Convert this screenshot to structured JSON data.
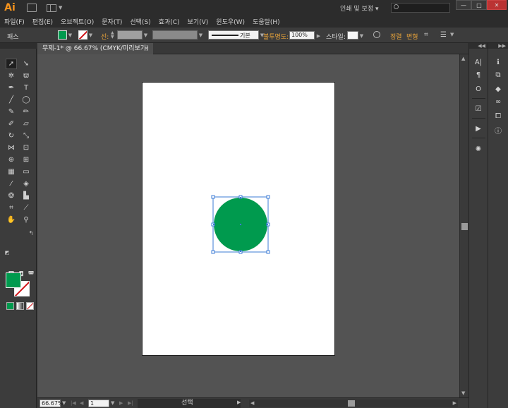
{
  "app": {
    "logo_text": "Ai",
    "workspace_label": "인쇄 및 보정",
    "search_placeholder": "",
    "window_controls": [
      "—",
      "□",
      "✕"
    ]
  },
  "menu": [
    "파일(F)",
    "편집(E)",
    "오브젝트(O)",
    "문자(T)",
    "선택(S)",
    "효과(C)",
    "보기(V)",
    "윈도우(W)",
    "도움말(H)"
  ],
  "controlbar": {
    "selection_label": "패스",
    "fill_color": "#009a4e",
    "stroke_label": "선:",
    "stroke_style_label": "기본",
    "opacity_label": "불투명도:",
    "opacity_value": "100%",
    "style_label": "스타일:",
    "align_label": "정렬",
    "transform_label": "변형"
  },
  "document": {
    "tab_title": "무제-1* @ 66.67% (CMYK/미리보기)",
    "tab_close": "×",
    "artboard_color": "#ffffff",
    "object": {
      "type": "circle",
      "fill": "#009a4e",
      "selected": true,
      "selection_color": "#3b7bd6"
    }
  },
  "statusbar": {
    "zoom": "66.67%",
    "page": "1",
    "status_text": "선택"
  },
  "tools": {
    "fill_color": "#009a4e",
    "stroke_color": "none"
  },
  "colors": {
    "ui_dark": "#3c3c3c",
    "canvas": "#535353",
    "accent_orange": "#e8a33a"
  }
}
